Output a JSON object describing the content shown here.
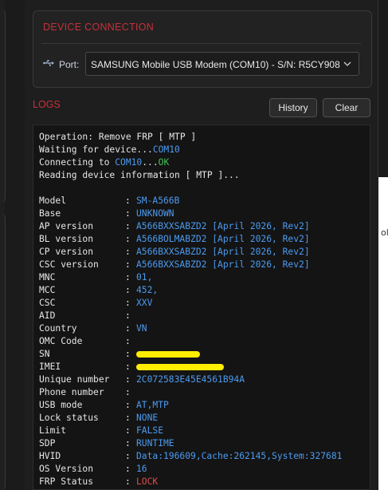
{
  "connection": {
    "title": "DEVICE CONNECTION",
    "port_label": "Port:",
    "port_value": "SAMSUNG Mobile USB Modem (COM10) - S/N: R5CY908"
  },
  "logs": {
    "title": "LOGS",
    "history_label": "History",
    "clear_label": "Clear",
    "header_lines": [
      {
        "text": "Operation: Remove FRP [ MTP ]",
        "suffix": "",
        "suffix_color": ""
      },
      {
        "text": "Waiting for device...",
        "suffix": "COM10",
        "suffix_color": "blue"
      },
      {
        "text": "Connecting to ",
        "suffix": "COM10",
        "suffix_color": "blue",
        "tail": "...",
        "tail2": "OK"
      },
      {
        "text": "Reading device information [ MTP ]...",
        "suffix": "",
        "suffix_color": ""
      }
    ],
    "fields": [
      {
        "key": "Model",
        "value": "SM-A566B",
        "color": "blue"
      },
      {
        "key": "Base",
        "value": "UNKNOWN",
        "color": "blue"
      },
      {
        "key": "AP version",
        "value": "A566BXXSABZD2 [April 2026, Rev2]",
        "color": "blue"
      },
      {
        "key": "BL version",
        "value": "A566BOLMABZD2 [April 2026, Rev2]",
        "color": "blue"
      },
      {
        "key": "CP version",
        "value": "A566BXXSABZD2 [April 2026, Rev2]",
        "color": "blue"
      },
      {
        "key": "CSC version",
        "value": "A566BXXSABZD2 [April 2026, Rev2]",
        "color": "blue"
      },
      {
        "key": "MNC",
        "value": "01,",
        "color": "blue"
      },
      {
        "key": "MCC",
        "value": "452,",
        "color": "blue"
      },
      {
        "key": "CSC",
        "value": "XXV",
        "color": "blue"
      },
      {
        "key": "AID",
        "value": "",
        "color": "blue"
      },
      {
        "key": "Country",
        "value": "VN",
        "color": "blue"
      },
      {
        "key": "OMC Code",
        "value": "",
        "color": "blue"
      },
      {
        "key": "SN",
        "value": "",
        "color": "redact",
        "redact_width": 80
      },
      {
        "key": "IMEI",
        "value": "",
        "color": "redact",
        "redact_width": 110
      },
      {
        "key": "Unique number",
        "value": "2C072583E45E4561B94A",
        "color": "blue"
      },
      {
        "key": "Phone number",
        "value": "",
        "color": "blue"
      },
      {
        "key": "USB mode",
        "value": "AT,MTP",
        "color": "blue"
      },
      {
        "key": "Lock status",
        "value": "NONE",
        "color": "blue"
      },
      {
        "key": "Limit",
        "value": "FALSE",
        "color": "blue"
      },
      {
        "key": "SDP",
        "value": "RUNTIME",
        "color": "blue"
      },
      {
        "key": "HVID",
        "value": "Data:196609,Cache:262145,System:327681",
        "color": "blue"
      },
      {
        "key": "OS Version",
        "value": "16",
        "color": "blue"
      },
      {
        "key": "FRP Status",
        "value": "LOCK",
        "color": "red"
      }
    ]
  },
  "edge": {
    "fragment": "ol"
  }
}
